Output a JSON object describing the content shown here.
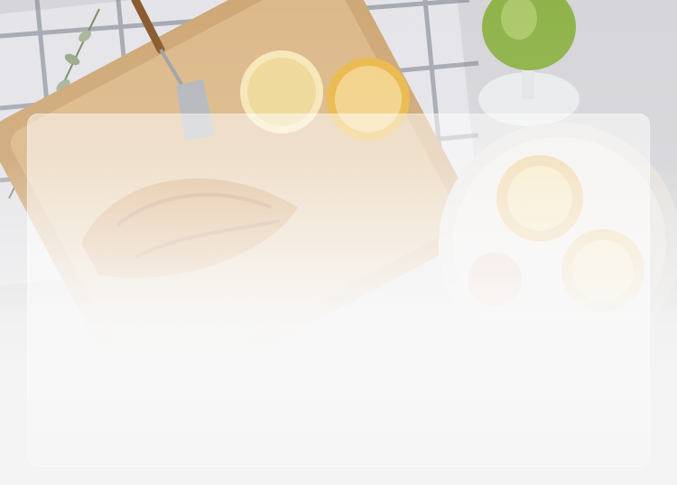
{
  "background": {
    "image_subject": "breakfast-table-photo",
    "colors": {
      "table": "#d9d8dc",
      "tray": "#dcb98a",
      "lemon": "#f3d38a",
      "drink": "#8fb34a",
      "plate": "#eeeae6",
      "fade": "#f4f4f4"
    }
  },
  "card": {
    "style": "frosted-glass",
    "content": ""
  }
}
